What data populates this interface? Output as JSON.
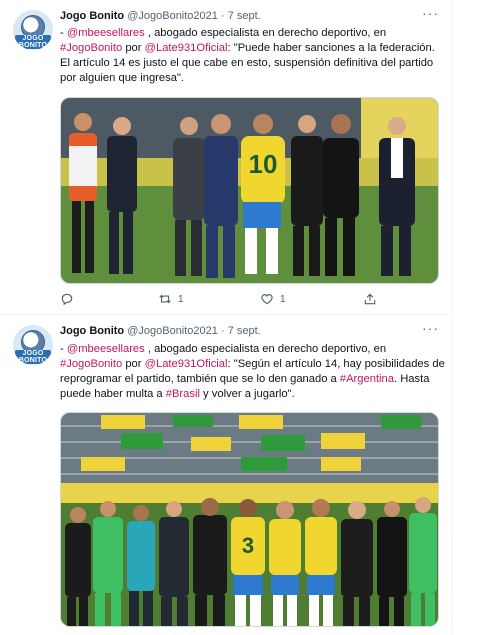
{
  "tweets": [
    {
      "author_name": "Jogo Bonito",
      "handle": "@JogoBonito2021",
      "separator": "·",
      "date": "7 sept.",
      "avatar_text": "JOGO BONITO",
      "text_parts": [
        {
          "t": "- ",
          "link": false
        },
        {
          "t": "@mbeesellares",
          "link": true
        },
        {
          "t": " , abogado especialista en derecho deportivo, en ",
          "link": false
        },
        {
          "t": "#JogoBonito",
          "link": true
        },
        {
          "t": " por ",
          "link": false
        },
        {
          "t": "@Late931Oficial",
          "link": true
        },
        {
          "t": ": \"Puede haber sanciones a la federación. El artículo 14 es justo el que cabe en esto, suspensión definitiva del partido por alguien que ingresa\".",
          "link": false
        }
      ],
      "image_alt": "Jugadores y dirigentes discuten en el campo",
      "jersey_number": "10",
      "actions": {
        "reply_count": "",
        "retweet_count": "1",
        "like_count": "1"
      }
    },
    {
      "author_name": "Jogo Bonito",
      "handle": "@JogoBonito2021",
      "separator": "·",
      "date": "7 sept.",
      "avatar_text": "JOGO BONITO",
      "text_parts": [
        {
          "t": "- ",
          "link": false
        },
        {
          "t": "@mbeesellares",
          "link": true
        },
        {
          "t": " , abogado especialista en derecho deportivo, en ",
          "link": false
        },
        {
          "t": "#JogoBonito",
          "link": true
        },
        {
          "t": " por ",
          "link": false
        },
        {
          "t": "@Late931Oficial",
          "link": true
        },
        {
          "t": ": \"Según el artículo 14, hay posibilidades de reprogramar el partido, también que se lo den ganado a ",
          "link": false
        },
        {
          "t": "#Argentina",
          "link": true
        },
        {
          "t": ". Hasta puede haber multa a ",
          "link": false
        },
        {
          "t": "#Brasil",
          "link": true
        },
        {
          "t": " y volver a jugarlo\".",
          "link": false
        }
      ],
      "image_alt": "Grupo de jugadores reunidos en el campo",
      "jersey_number": "3"
    }
  ],
  "colors": {
    "link": "#c2185b",
    "muted": "#536471",
    "pitch": "#5f8f3c"
  },
  "icons": [
    "reply-icon",
    "retweet-icon",
    "like-icon",
    "share-icon",
    "more-icon"
  ]
}
